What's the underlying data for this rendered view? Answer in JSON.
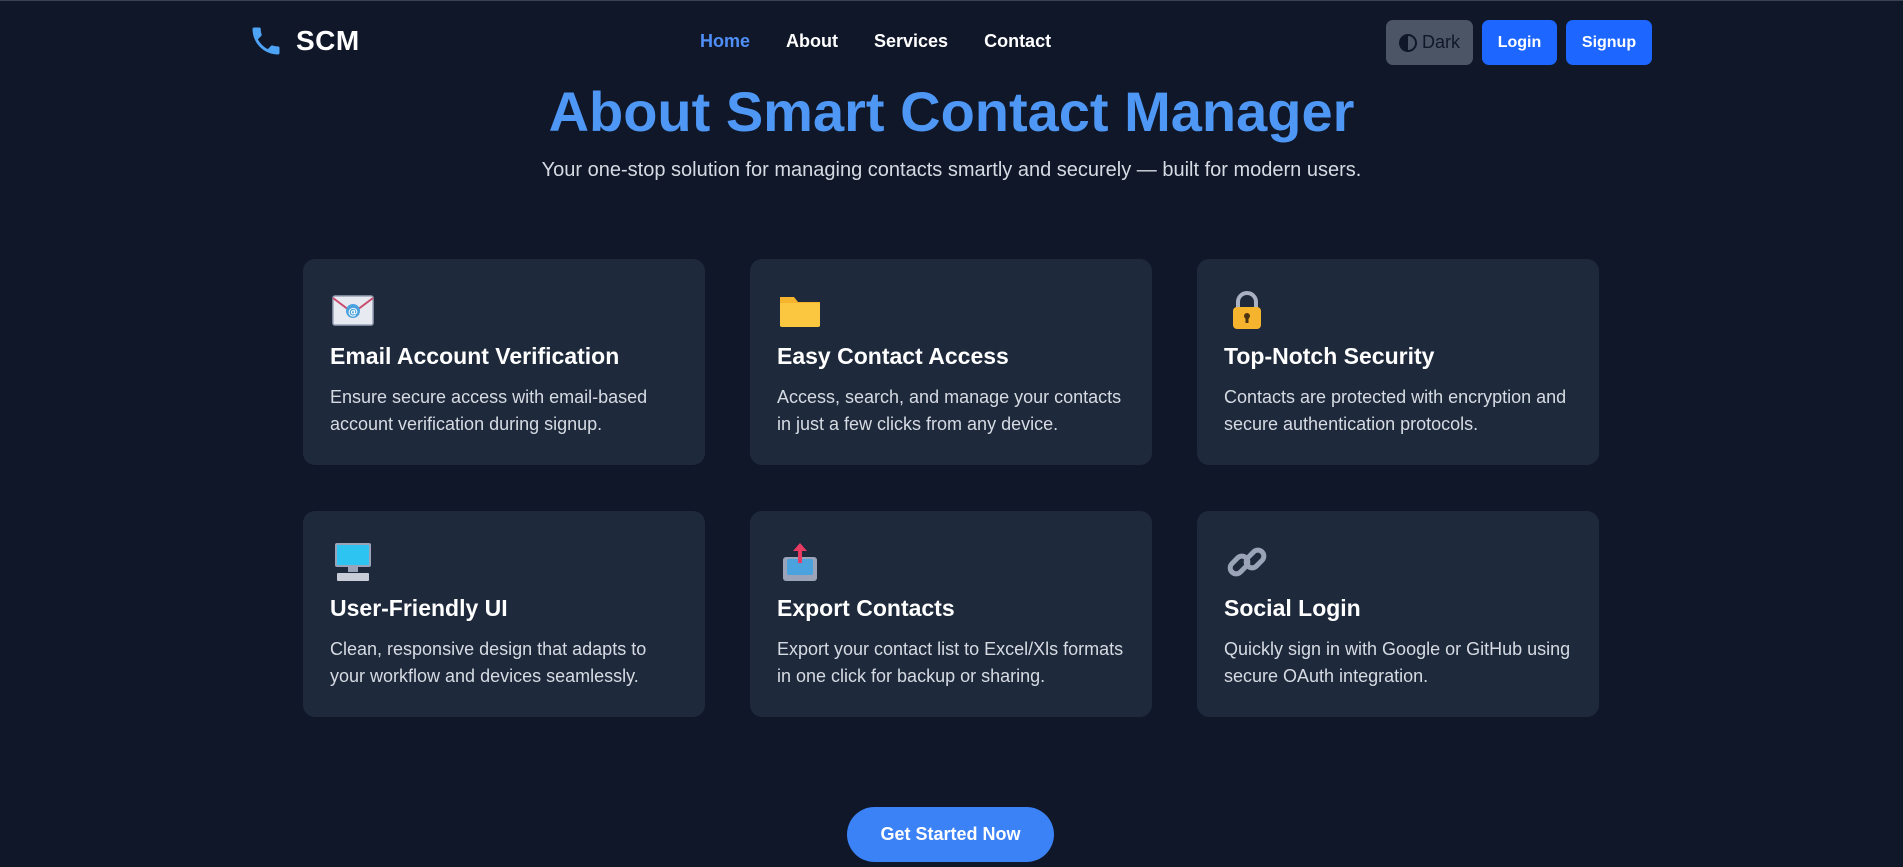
{
  "brand": {
    "name": "SCM",
    "icon": "phone-icon"
  },
  "nav": {
    "links": [
      {
        "label": "Home",
        "active": true
      },
      {
        "label": "About",
        "active": false
      },
      {
        "label": "Services",
        "active": false
      },
      {
        "label": "Contact",
        "active": false
      }
    ],
    "theme_label": "Dark",
    "login_label": "Login",
    "signup_label": "Signup"
  },
  "hero": {
    "title": "About Smart Contact Manager",
    "subtitle": "Your one-stop solution for managing contacts smartly and securely — built for modern users."
  },
  "features": [
    {
      "icon": "email-icon",
      "title": "Email Account Verification",
      "desc": "Ensure secure access with email-based account verification during signup."
    },
    {
      "icon": "folder-icon",
      "title": "Easy Contact Access",
      "desc": "Access, search, and manage your contacts in just a few clicks from any device."
    },
    {
      "icon": "lock-icon",
      "title": "Top-Notch Security",
      "desc": "Contacts are protected with encryption and secure authentication protocols."
    },
    {
      "icon": "computer-icon",
      "title": "User-Friendly UI",
      "desc": "Clean, responsive design that adapts to your workflow and devices seamlessly."
    },
    {
      "icon": "export-icon",
      "title": "Export Contacts",
      "desc": "Export your contact list to Excel/Xls formats in one click for backup or sharing."
    },
    {
      "icon": "link-icon",
      "title": "Social Login",
      "desc": "Quickly sign in with Google or GitHub using secure OAuth integration."
    }
  ],
  "cta": {
    "label": "Get Started Now"
  },
  "colors": {
    "background": "#0f1729",
    "card": "#1e293b",
    "accent": "#4e97f5",
    "button": "#1d66ff"
  }
}
